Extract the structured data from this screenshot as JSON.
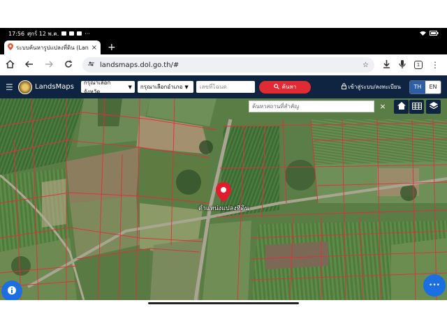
{
  "status": {
    "time": "17:56",
    "date": "ศุกร์ 12 พ.ค."
  },
  "tab": {
    "title": "ระบบค้นหารูปแปลงที่ดิน (Land",
    "close": "×",
    "new_tab": "+"
  },
  "browser": {
    "url": "landsmaps.dol.go.th/#",
    "tab_count": "1"
  },
  "app": {
    "brand": "LandsMaps",
    "province_select": "กรุณาเลือกจังหวัด",
    "district_select": "กรุณาเลือกอำเภอ",
    "parcel_placeholder": "เลขที่โฉนด",
    "search_label": "ค้นหา",
    "login_label": "เข้าสู่ระบบ/ลงทะเบียน",
    "lang_th": "TH",
    "lang_en": "EN"
  },
  "map": {
    "place_search_placeholder": "ค้นหาสถานที่สำคัญ",
    "close": "×",
    "pin_label": "ตำแหน่งแปลงที่ดิน",
    "more_button": "•••"
  },
  "colors": {
    "app_bar": "#0f2440",
    "search_button": "#e22a35",
    "parcel_border": "#e0303a",
    "fab": "#1c6fe0"
  }
}
